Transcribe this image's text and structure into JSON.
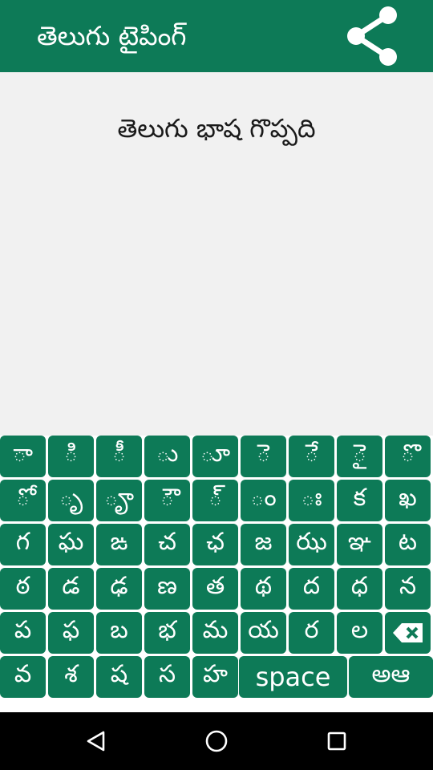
{
  "app": {
    "title": "తెలుగు టైపింగ్",
    "share_icon": "share-icon"
  },
  "editor": {
    "text": "తెలుగు భాష గొప్పది"
  },
  "keyboard": {
    "rows": [
      [
        "ా",
        "ి",
        "ీ",
        "ు",
        "ూ",
        "ె",
        "ే",
        "ై",
        "ొ"
      ],
      [
        "ో",
        "ృ",
        "ౄ",
        "ౌ",
        "్",
        "ం",
        "ః",
        "క",
        "ఖ"
      ],
      [
        "గ",
        "ఘ",
        "ఙ",
        "చ",
        "ఛ",
        "జ",
        "ఝ",
        "ఞ",
        "ట"
      ],
      [
        "ఠ",
        "డ",
        "ఢ",
        "ణ",
        "త",
        "థ",
        "ద",
        "ధ",
        "న"
      ],
      [
        "ప",
        "ఫ",
        "బ",
        "భ",
        "మ",
        "య",
        "ర",
        "ల"
      ],
      [
        "వ",
        "శ",
        "ష",
        "స",
        "హ"
      ]
    ],
    "backspace_icon": "backspace-icon",
    "space_label": "space",
    "vowel_switch_label": "అఆ"
  },
  "navigation": {
    "back_icon": "back-triangle-icon",
    "home_icon": "home-circle-icon",
    "recents_icon": "recents-square-icon"
  },
  "colors": {
    "primary": "#0d7a57",
    "key_text": "#ffffff",
    "editor_bg": "#f1f1f1",
    "nav_bg": "#000000"
  }
}
